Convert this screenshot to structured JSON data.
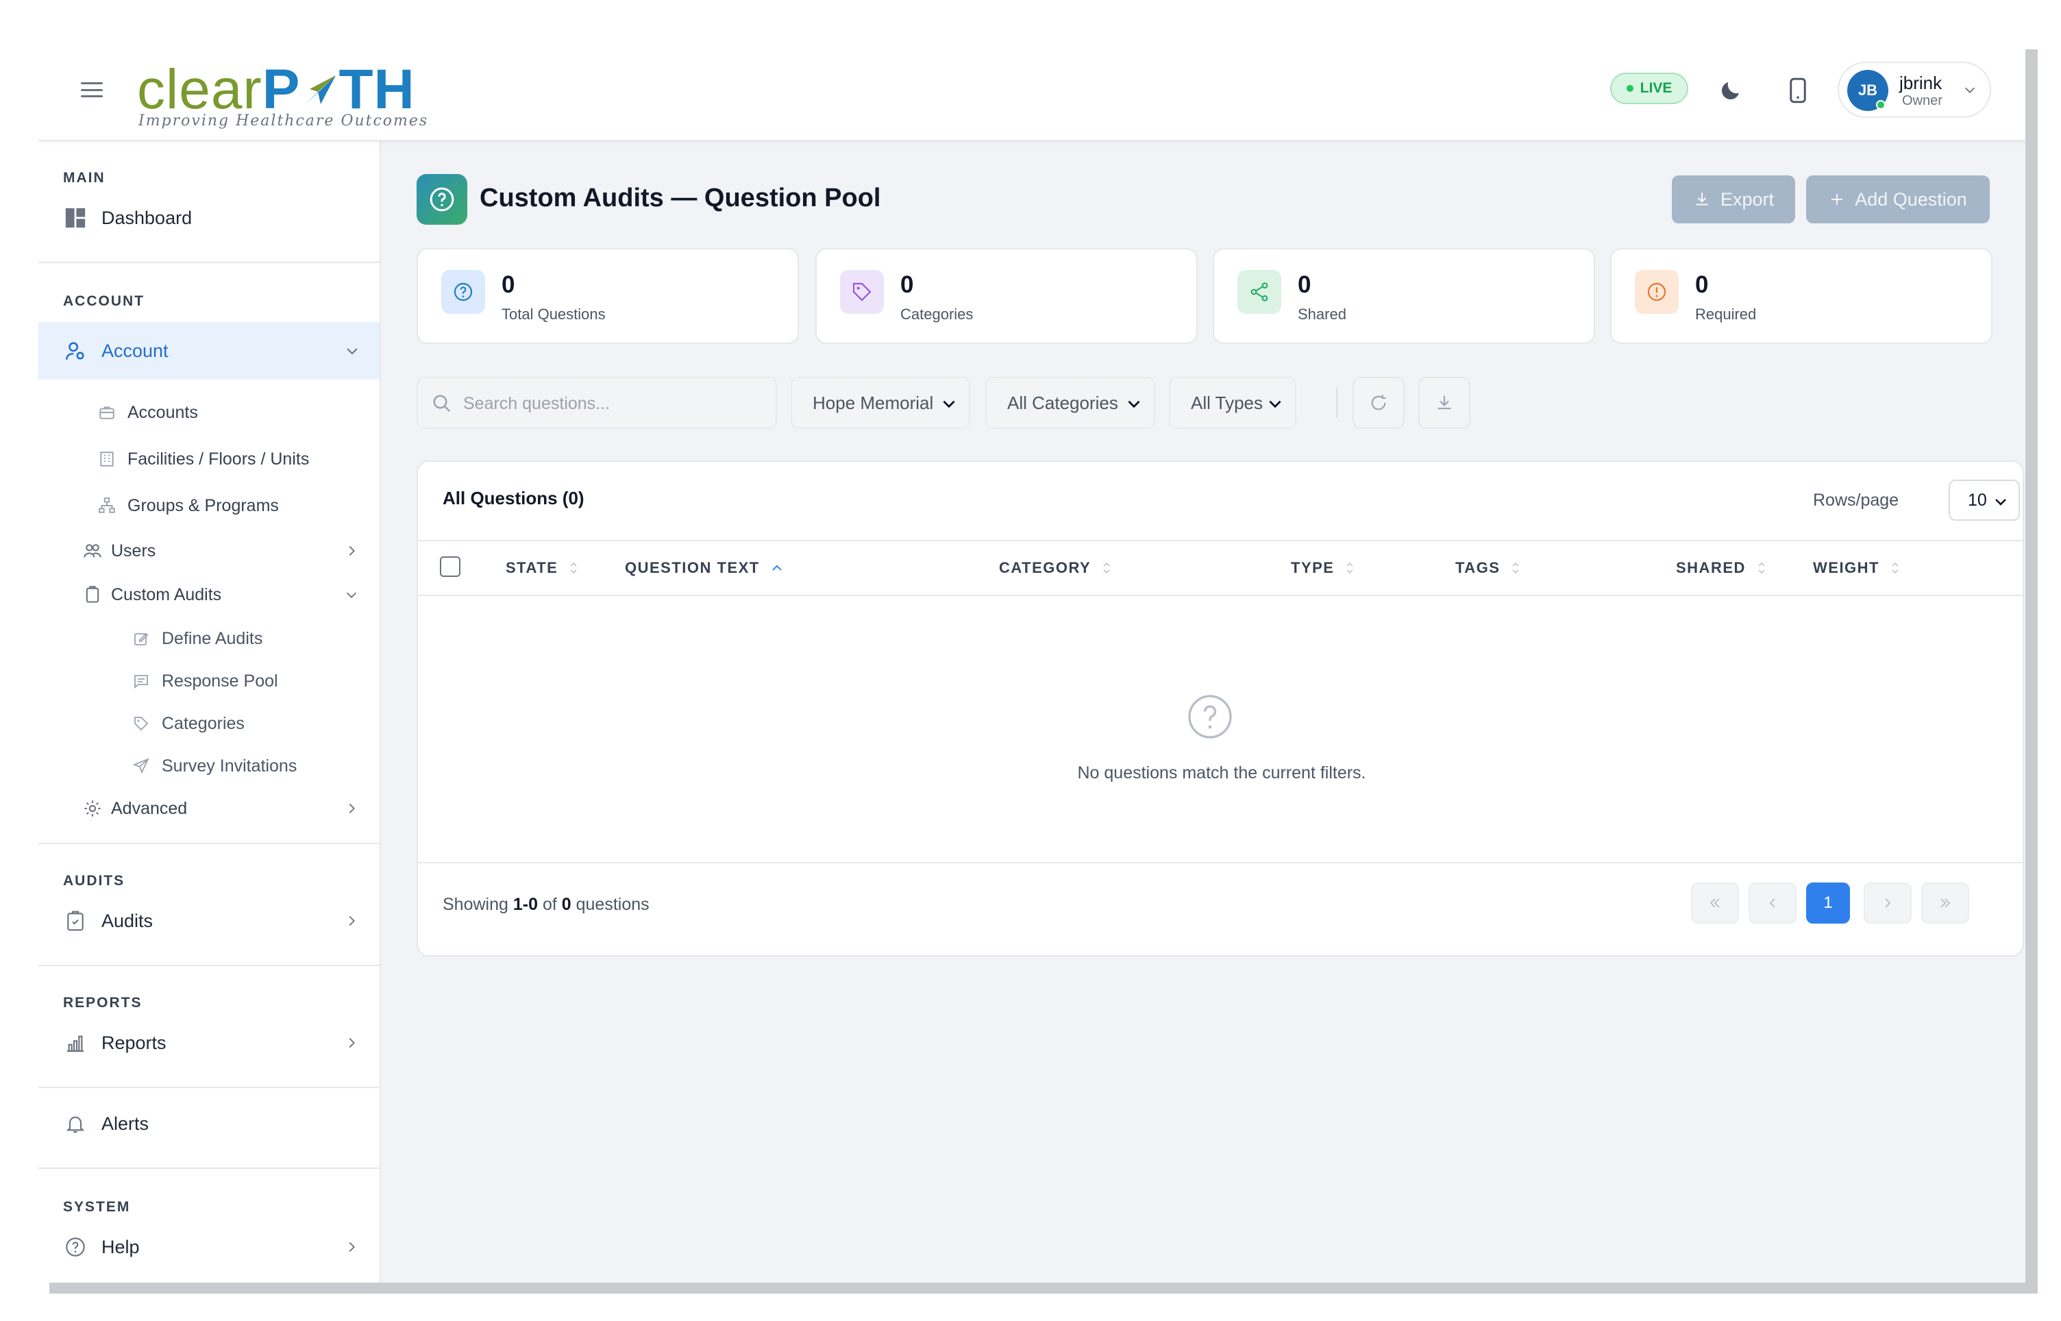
{
  "header": {
    "logo_text_a": "clear",
    "logo_text_b": "P",
    "logo_text_c": "TH",
    "logo_tagline": "Improving Healthcare Outcomes",
    "live_badge": "LIVE",
    "user": {
      "initials": "JB",
      "name": "jbrink",
      "role": "Owner"
    }
  },
  "sidebar": {
    "main_title": "MAIN",
    "dashboard": "Dashboard",
    "account_title": "ACCOUNT",
    "account": "Account",
    "accounts": "Accounts",
    "facilities": "Facilities / Floors / Units",
    "groups": "Groups & Programs",
    "users": "Users",
    "custom_audits": "Custom Audits",
    "define_audits": "Define Audits",
    "response_pool": "Response Pool",
    "categories": "Categories",
    "survey_invitations": "Survey Invitations",
    "advanced": "Advanced",
    "audits_title": "AUDITS",
    "audits": "Audits",
    "reports_title": "REPORTS",
    "reports": "Reports",
    "alerts": "Alerts",
    "system_title": "SYSTEM",
    "help": "Help"
  },
  "page": {
    "title": "Custom Audits — Question Pool",
    "export_label": "Export",
    "add_label": "Add Question"
  },
  "stats": [
    {
      "value": "0",
      "label": "Total Questions",
      "color": "#1f7ac2"
    },
    {
      "value": "0",
      "label": "Categories",
      "color": "#9b51e0"
    },
    {
      "value": "0",
      "label": "Shared",
      "color": "#27ae60"
    },
    {
      "value": "0",
      "label": "Required",
      "color": "#e8762c"
    }
  ],
  "filters": {
    "search_placeholder": "Search questions...",
    "facility": "Hope Memorial",
    "category": "All Categories",
    "type": "All Types"
  },
  "table": {
    "title": "All Questions (0)",
    "rows_label": "Rows/page",
    "rows_value": "10",
    "columns": [
      "STATE",
      "QUESTION TEXT",
      "CATEGORY",
      "TYPE",
      "TAGS",
      "SHARED",
      "WEIGHT"
    ],
    "empty_message": "No questions match the current filters.",
    "showing_prefix": "Showing",
    "showing_range": "1-0",
    "showing_of": "of",
    "showing_total": "0",
    "showing_suffix": "questions",
    "current_page": "1"
  }
}
